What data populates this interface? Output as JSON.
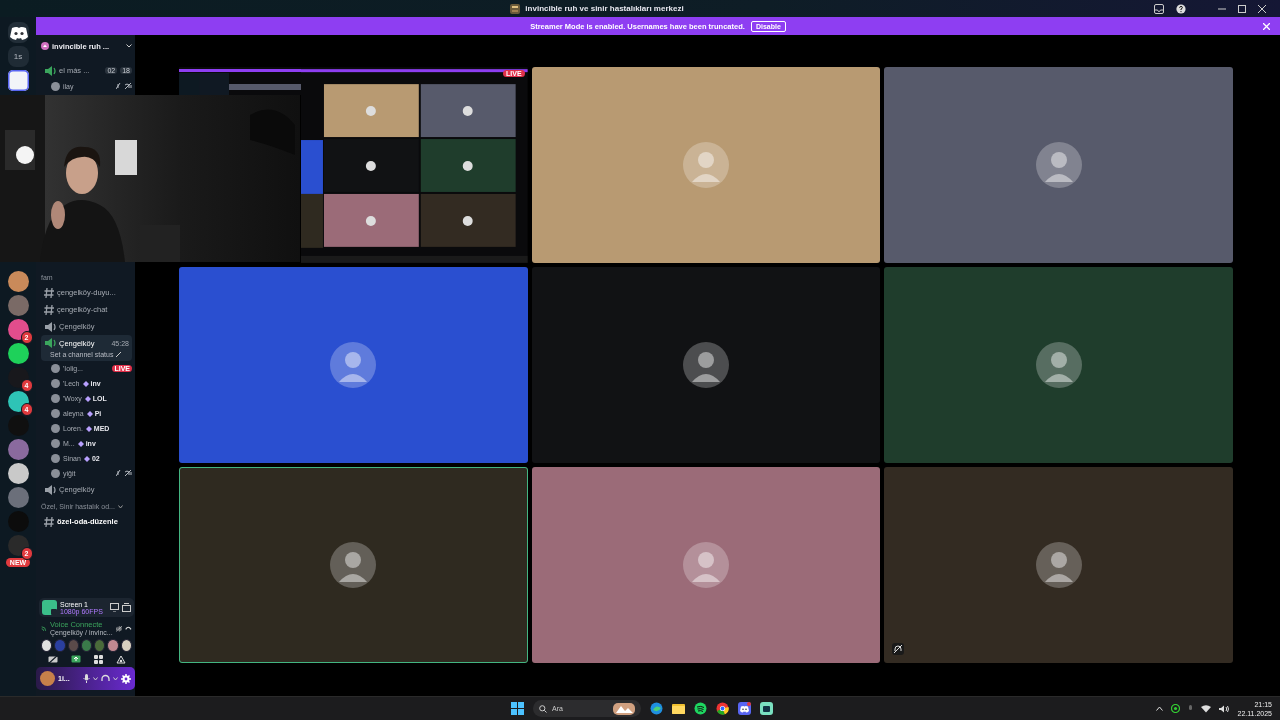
{
  "window": {
    "title": "invincible ruh ve sinir hastalıkları merkezi"
  },
  "banner": {
    "text": "Streamer Mode is enabled. Usernames have been truncated.",
    "button": "Disable"
  },
  "rail": {
    "top": [
      {
        "kind": "home"
      },
      {
        "kind": "label",
        "label": "1s"
      },
      {
        "kind": "server",
        "color": "#f2f4f8",
        "selected": true
      }
    ],
    "bottom": [
      {
        "kind": "server",
        "color": "#c98a5a",
        "selected": false
      },
      {
        "kind": "server",
        "color": "#7a6a66",
        "selected": false
      },
      {
        "kind": "server",
        "color": "#e24d8c",
        "badge": "2",
        "selected": false
      },
      {
        "kind": "server",
        "color": "#1ed15a",
        "selected": false
      },
      {
        "kind": "server",
        "color": "#18181c",
        "badge": "4",
        "selected": false
      },
      {
        "kind": "server",
        "color": "#2ec4b6",
        "badge": "4",
        "selected": false
      },
      {
        "kind": "server",
        "color": "#101010",
        "selected": false
      },
      {
        "kind": "server",
        "color": "#8a6a9e",
        "selected": false
      },
      {
        "kind": "server",
        "color": "#c9c9c9",
        "selected": false
      },
      {
        "kind": "server",
        "color": "#6b6f7a",
        "selected": false
      },
      {
        "kind": "server",
        "color": "#0c0c0c",
        "selected": false
      },
      {
        "kind": "server",
        "color": "#2a2a2a",
        "badge": "2",
        "selected": false
      }
    ],
    "new_badge": "NEW"
  },
  "sidebar": {
    "server_name": "invincible ruh ...",
    "top_channel": {
      "name": "el más ...",
      "counts": [
        "02",
        "18"
      ]
    },
    "top_users": [
      {
        "name": "ilay",
        "muted": true
      }
    ],
    "category": "fam",
    "channels": [
      {
        "kind": "text",
        "name": "çengelköy-duyu..."
      },
      {
        "kind": "text",
        "name": "çengelköy-chat"
      },
      {
        "kind": "voice",
        "name": "Çengelköy"
      }
    ],
    "active_channel": {
      "name": "Çengelköy",
      "timer": "45:28",
      "status": "Set a channel status",
      "selected": true
    },
    "users": [
      {
        "name": "'Iolig...",
        "live": "LIVE",
        "muted": false
      },
      {
        "name": "'Lech",
        "tag": "inv",
        "muted": false
      },
      {
        "name": "'Woxy",
        "tag": "LOL",
        "muted": false
      },
      {
        "name": "aleyna",
        "tag": "Pi",
        "muted": false
      },
      {
        "name": "Loren.",
        "tag": "MED",
        "muted": false
      },
      {
        "name": "M...",
        "tag": "inv",
        "muted": false
      },
      {
        "name": "Sinan",
        "tag": "02",
        "muted": false
      },
      {
        "name": "yiğit",
        "muted": true
      }
    ],
    "after_channels": [
      {
        "kind": "voice",
        "name": "Çengelköy",
        "unread": false
      }
    ],
    "category_2": "Özel, Sinir hastalık od...",
    "after_category": [
      {
        "kind": "text",
        "name": "özel-oda-düzenle",
        "unread": true
      }
    ]
  },
  "stream_panel": {
    "title": "Screen 1",
    "quality": "1080p 60FPS"
  },
  "voice_panel": {
    "status": "Voice Connecte",
    "channel": "Çengelköy / invinc...",
    "avatars": [
      {
        "color": "#e0e0e0"
      },
      {
        "color": "#2a3fa0"
      },
      {
        "color": "#5a4a4a"
      },
      {
        "color": "#3a7a4a"
      },
      {
        "color": "#4a6a3a"
      },
      {
        "color": "#c08890"
      },
      {
        "color": "#d8d0c0"
      }
    ]
  },
  "user_panel": {
    "name": "1i..."
  },
  "tiles": [
    {
      "kind": "stream",
      "live": "LIVE",
      "speaking": false,
      "muted": false
    },
    {
      "kind": "avatar",
      "color": "#b89a72",
      "speaking": false,
      "muted": false
    },
    {
      "kind": "avatar",
      "color": "#575a6b",
      "speaking": false,
      "muted": false
    },
    {
      "kind": "avatar",
      "color": "#2a4fd0",
      "speaking": false,
      "muted": false
    },
    {
      "kind": "avatar",
      "color": "#111214",
      "speaking": false,
      "muted": false
    },
    {
      "kind": "avatar",
      "color": "#1f3d2c",
      "speaking": false,
      "muted": false
    },
    {
      "kind": "avatar",
      "color": "#2f2a20",
      "speaking": true,
      "muted": false
    },
    {
      "kind": "avatar",
      "color": "#9b6b78",
      "speaking": false,
      "muted": false
    },
    {
      "kind": "avatar",
      "color": "#332b22",
      "speaking": false,
      "muted": true
    }
  ],
  "taskbar": {
    "search": "Ara",
    "time": "21:15",
    "date": "22.11.2025"
  }
}
